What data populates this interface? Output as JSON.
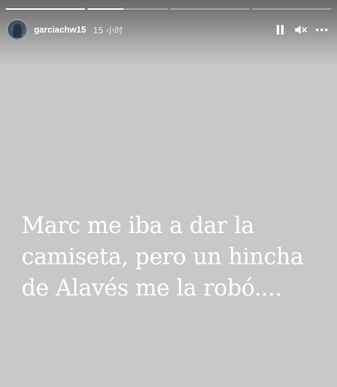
{
  "story": {
    "progress_segments": [
      {
        "fill": 1.0
      },
      {
        "fill": 0.45
      },
      {
        "fill": 0.0
      },
      {
        "fill": 0.0
      }
    ],
    "user": {
      "username": "garciachw15",
      "time_ago": "15 小时"
    },
    "controls": {
      "pause_icon": "pause-icon",
      "mute_icon": "muted-speaker-icon",
      "more_icon": "more-options-icon"
    },
    "caption": "Marc me iba a dar la camiseta, pero un hincha de Alavés me la robó....",
    "colors": {
      "background": "#c8c8c8",
      "text": "#ffffff"
    }
  }
}
